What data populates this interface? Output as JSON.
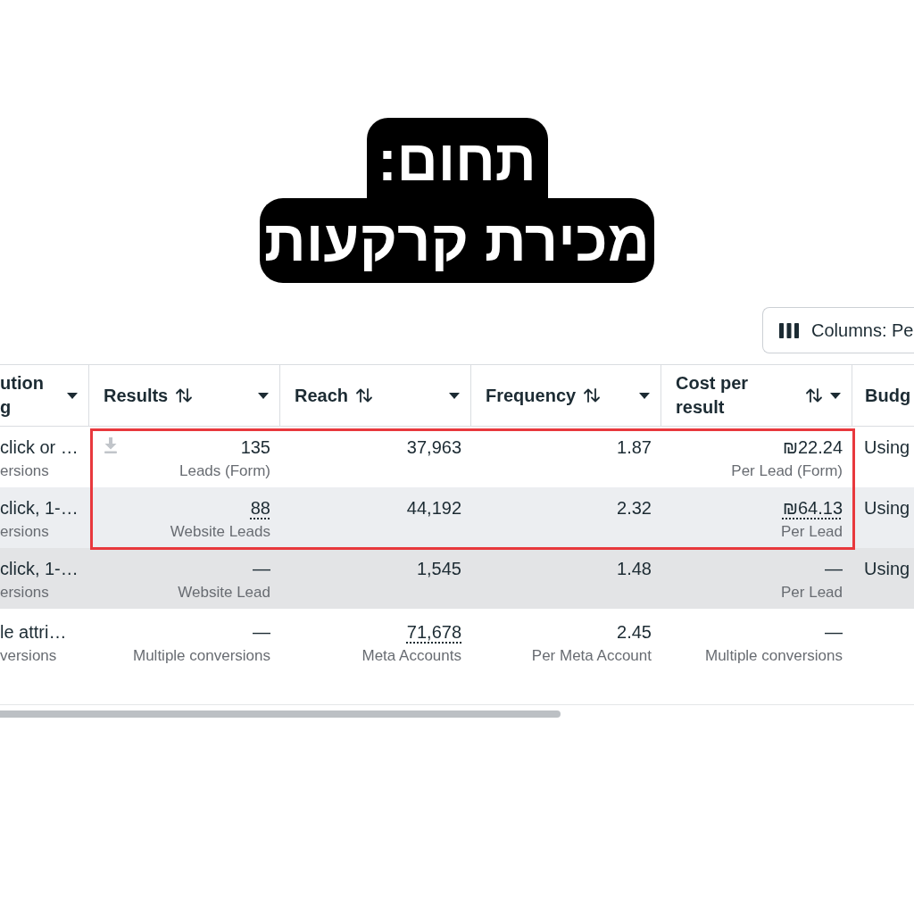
{
  "heading": {
    "label": "תחום:",
    "title": "מכירת קרקעות"
  },
  "columns_button": {
    "label": "Columns: Pe"
  },
  "table": {
    "columns": [
      {
        "label": "ution\ng",
        "kind": "text"
      },
      {
        "label": "Results",
        "kind": "metric"
      },
      {
        "label": "Reach",
        "kind": "metric"
      },
      {
        "label": "Frequency",
        "kind": "metric"
      },
      {
        "label": "Cost per result",
        "kind": "metric"
      },
      {
        "label": "Budg",
        "kind": "edge"
      }
    ],
    "highlighted_rows": [
      {
        "striped": false,
        "hovered": false,
        "cells": [
          {
            "kind": "text",
            "value": "click or …",
            "caption": "ersions"
          },
          {
            "kind": "download",
            "value": "135",
            "caption": "Leads (Form)"
          },
          {
            "kind": "number",
            "value": "37,963"
          },
          {
            "kind": "number",
            "value": "1.87"
          },
          {
            "kind": "number",
            "value": "₪22.24",
            "caption": "Per Lead (Form)"
          },
          {
            "kind": "text",
            "value": "Using"
          }
        ]
      },
      {
        "striped": true,
        "hovered": false,
        "cells": [
          {
            "kind": "text",
            "value": "click, 1-…",
            "caption": "ersions"
          },
          {
            "kind": "link",
            "value": "88",
            "caption": "Website Leads"
          },
          {
            "kind": "number",
            "value": "44,192"
          },
          {
            "kind": "number",
            "value": "2.32"
          },
          {
            "kind": "link",
            "value": "₪64.13",
            "caption": "Per Lead"
          },
          {
            "kind": "text",
            "value": "Using"
          }
        ]
      }
    ],
    "rows": [
      {
        "striped": false,
        "hovered": true,
        "cells": [
          {
            "kind": "text",
            "value": "click, 1-…",
            "caption": "ersions"
          },
          {
            "kind": "number",
            "value": "—",
            "caption": "Website Lead"
          },
          {
            "kind": "number",
            "value": "1,545"
          },
          {
            "kind": "number",
            "value": "1.48"
          },
          {
            "kind": "number",
            "value": "—",
            "caption": "Per Lead"
          },
          {
            "kind": "text",
            "value": "Using"
          }
        ]
      },
      {
        "striped": false,
        "hovered": false,
        "cells": [
          {
            "kind": "text",
            "value": "le attri…",
            "caption": "versions"
          },
          {
            "kind": "number",
            "value": "—",
            "caption": "Multiple conversions"
          },
          {
            "kind": "link",
            "value": "71,678",
            "caption": "Meta Accounts"
          },
          {
            "kind": "number",
            "value": "2.45",
            "caption": "Per Meta Account"
          },
          {
            "kind": "number",
            "value": "—",
            "caption": "Multiple conversions"
          }
        ]
      }
    ]
  }
}
